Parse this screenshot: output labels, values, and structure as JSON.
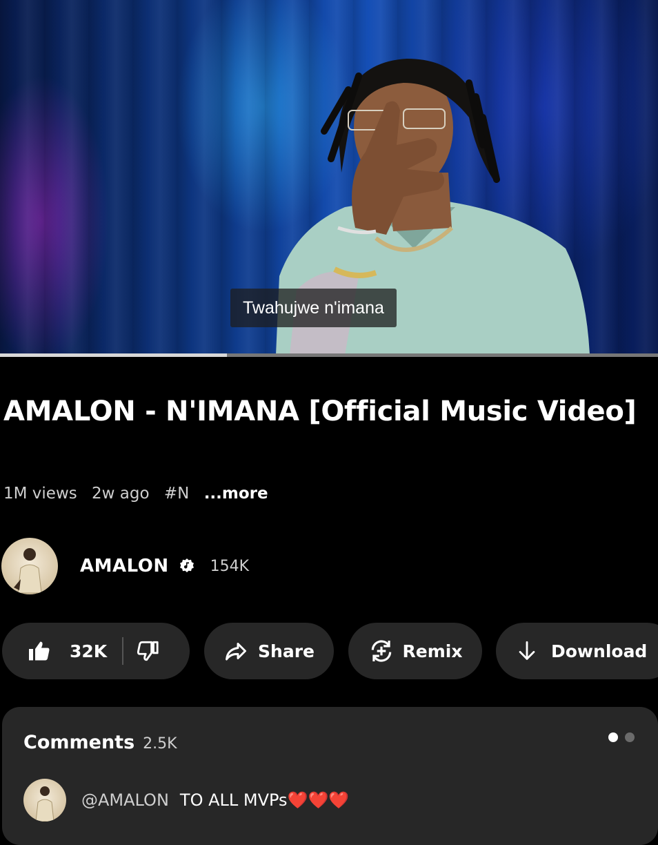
{
  "video": {
    "subtitle": "Twahujwe n'imana",
    "progress_fraction": 0.345
  },
  "title": "AMALON - N'IMANA [Official Music Video]",
  "meta": {
    "views": "1M views",
    "age": "2w ago",
    "hashtag": "#N",
    "more": "...more"
  },
  "channel": {
    "name": "AMALON",
    "verified_icon": "verified-music-icon",
    "subscribers": "154K"
  },
  "actions": {
    "like_count": "32K",
    "like_icon": "thumbs-up-icon",
    "dislike_icon": "thumbs-down-icon",
    "share_label": "Share",
    "share_icon": "share-arrow-icon",
    "remix_label": "Remix",
    "remix_icon": "remix-icon",
    "download_label": "Download",
    "download_icon": "download-arrow-icon"
  },
  "comments": {
    "title": "Comments",
    "count": "2.5K",
    "first": {
      "user": "@AMALON",
      "text": "TO ALL MVPs❤️❤️❤️"
    },
    "pager_active_color": "#ffffff",
    "pager_inactive_color": "#6b6b6b"
  },
  "colors": {
    "background": "#000000",
    "pill": "#272727",
    "muted_text": "#cfcfcf"
  }
}
